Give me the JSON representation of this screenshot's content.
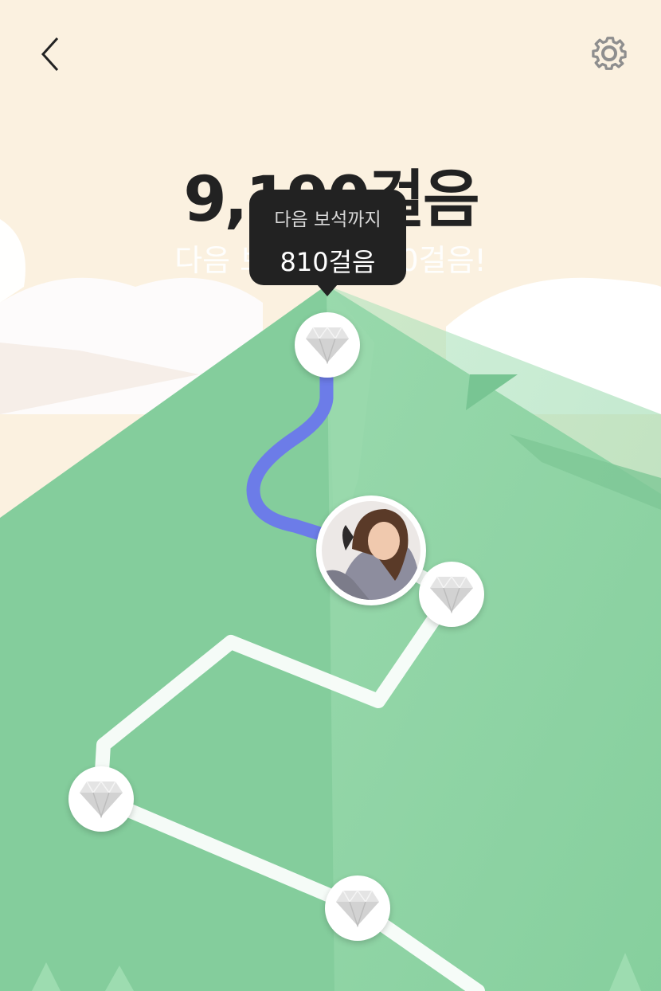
{
  "header": {
    "back_icon": "chevron-left-icon",
    "settings_icon": "gear-icon"
  },
  "summary": {
    "total_steps": "9,190걸음",
    "goal_text": "다음 보석까지 810걸음!"
  },
  "tooltip": {
    "label": "다음 보석까지",
    "value": "810걸음"
  },
  "path": {
    "gem_icon": "diamond-icon",
    "gem_count": 5,
    "user_avatar": "user-avatar-photo"
  },
  "colors": {
    "sky": "#fbf1e0",
    "mountain": "#84cd9c",
    "progress_path": "#6c7ce8",
    "remaining_path": "#ffffff",
    "tooltip_bg": "#222222"
  }
}
